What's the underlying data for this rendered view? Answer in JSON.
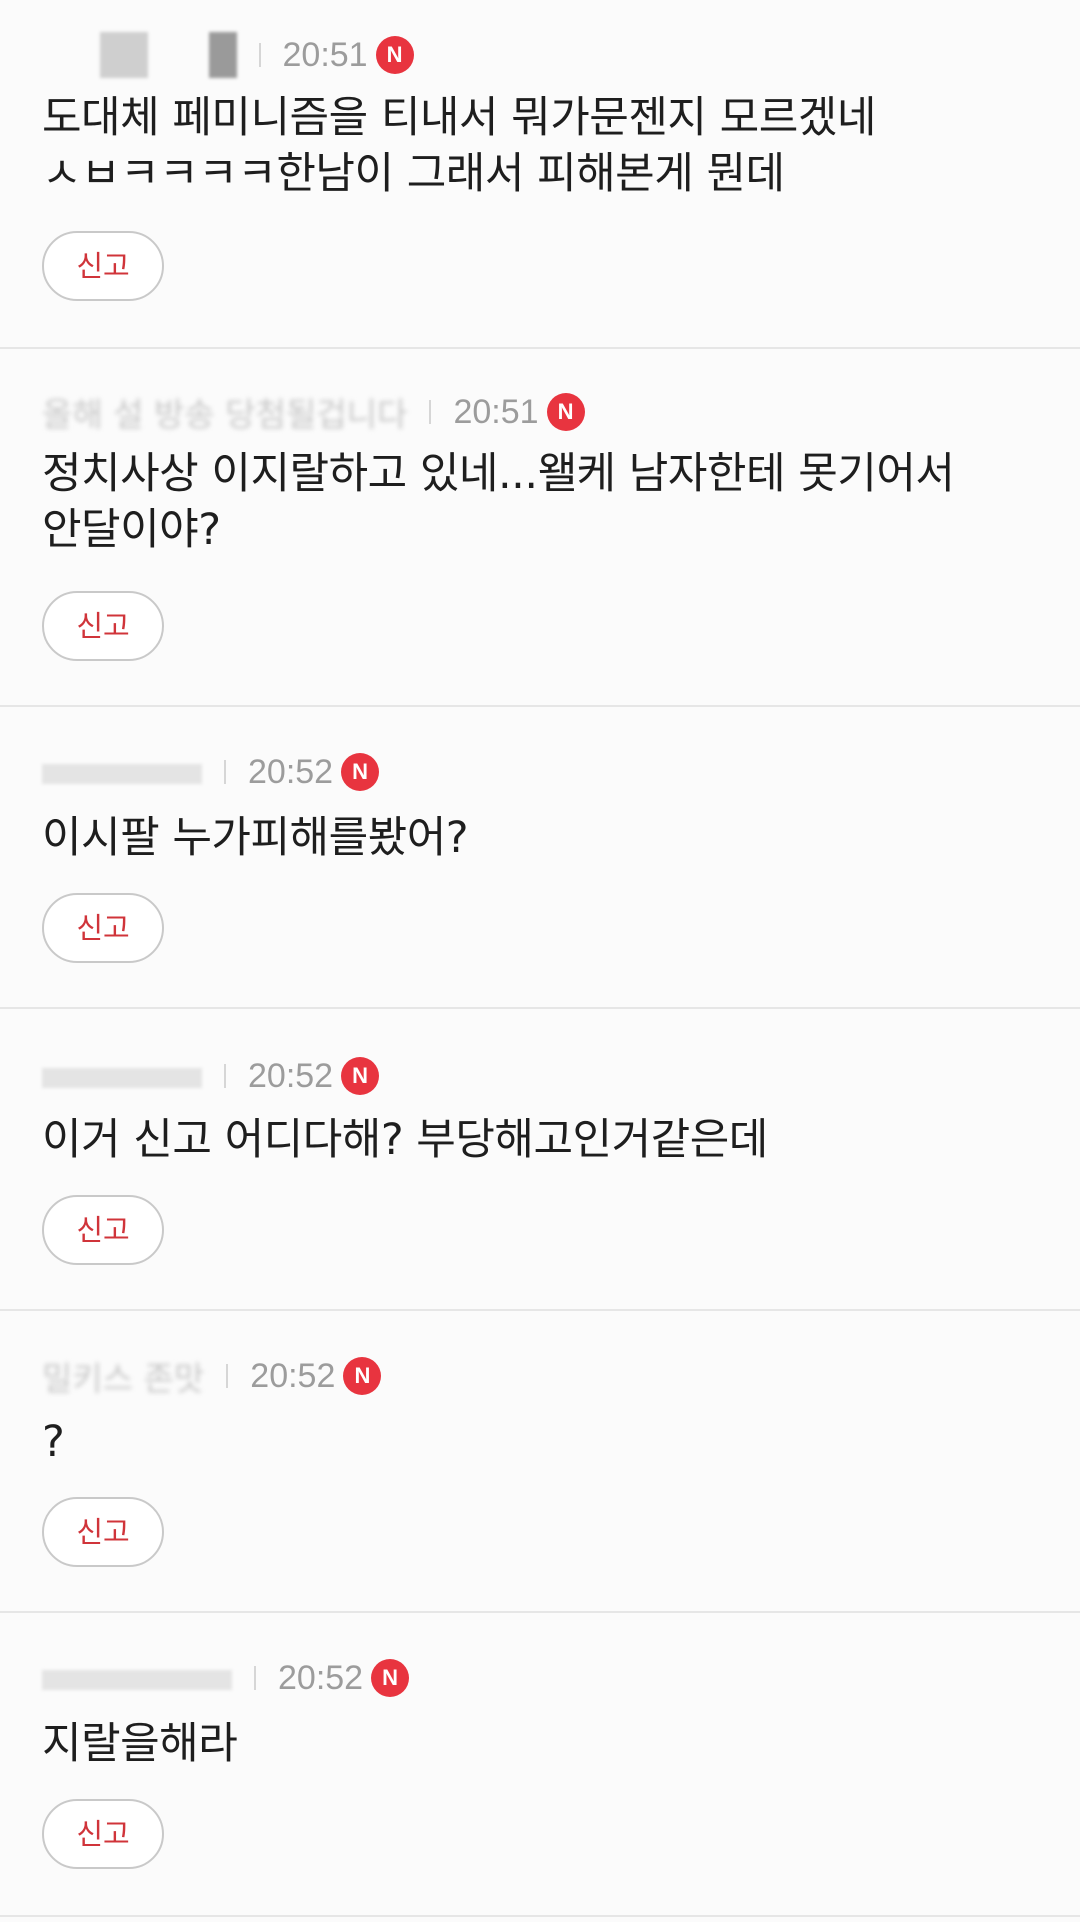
{
  "comments": [
    {
      "author": "",
      "time": "20:51",
      "badge": "N",
      "text": "도대체 페미니즘을 티내서 뭐가문젠지 모르겠네 ㅅㅂㅋㅋㅋㅋ한남이 그래서 피해본게 뭔데",
      "report_label": "신고"
    },
    {
      "author": "올해 설 방송 당첨될겁니다",
      "time": "20:51",
      "badge": "N",
      "text": "정치사상 이지랄하고 있네...왤케 남자한테 못기어서 안달이야?",
      "report_label": "신고"
    },
    {
      "author": "",
      "time": "20:52",
      "badge": "N",
      "text": "이시팔 누가피해를봤어?",
      "report_label": "신고"
    },
    {
      "author": "",
      "time": "20:52",
      "badge": "N",
      "text": "이거 신고 어디다해? 부당해고인거같은데",
      "report_label": "신고"
    },
    {
      "author": "밀키스 존맛",
      "time": "20:52",
      "badge": "N",
      "text": "?",
      "report_label": "신고"
    },
    {
      "author": "",
      "time": "20:52",
      "badge": "N",
      "text": "지랄을해라",
      "report_label": "신고"
    }
  ],
  "colors": {
    "badge": "#e8343f",
    "report_text": "#d0343a",
    "divider": "#e6e6e6",
    "background": "#fbfbfb"
  }
}
